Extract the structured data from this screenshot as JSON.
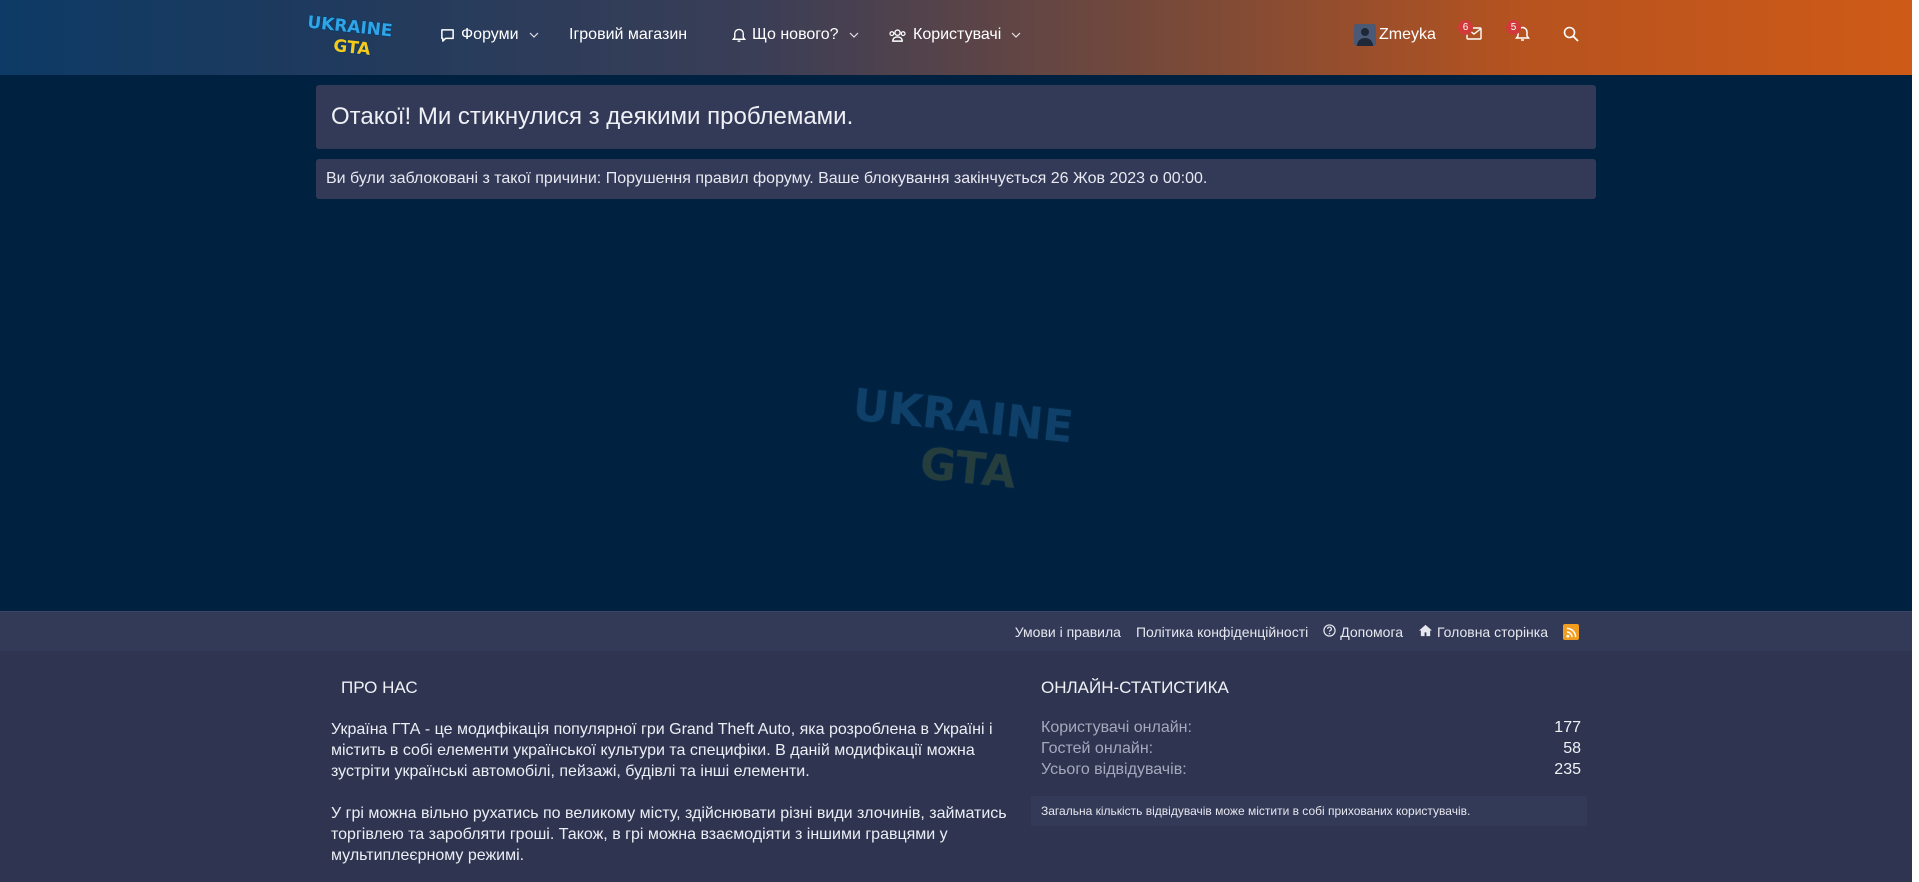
{
  "header": {
    "logo_line1": "UKRAINE",
    "logo_line2": "GTA",
    "nav": [
      {
        "label": "Форуми",
        "icon": "comment-icon"
      },
      {
        "label": "Ігровий магазин"
      },
      {
        "label": "Що нового?",
        "icon": "bell-icon"
      },
      {
        "label": "Користувачі",
        "icon": "users-icon"
      }
    ],
    "user": {
      "name": "Zmeyka"
    },
    "conversations_count": "6",
    "alerts_count": "5"
  },
  "main": {
    "title": "Отакої! Ми стикнулися з деякими проблемами.",
    "message": "Ви були заблоковані з такої причини: Порушення правил форуму. Ваше блокування закінчується 26 Жов 2023 о 00:00.",
    "watermark_line1": "UKRAINE",
    "watermark_line2": "GTA"
  },
  "footer": {
    "links": {
      "terms": "Умови і правила",
      "privacy": "Політика конфіденційності",
      "help": "Допомога",
      "home": "Головна сторінка"
    },
    "about": {
      "heading": "ПРО НАС",
      "p1_lines": [
        "Україна ГТА - це модифікація популярної гри Grand Theft Auto, яка розроблена в Україні і",
        "містить в собі елементи української культури та специфіки. В даній модифікації можна",
        "зустріти українські автомобілі, пейзажі, будівлі та інші елементи."
      ],
      "p2_lines": [
        "У грі можна вільно рухатись по великому місту, здійснювати різні види злочинів, займатись",
        "торгівлею та заробляти гроші. Також, в грі можна взаємодіяти з іншими гравцями у",
        "мультиплеєрному режимі."
      ]
    },
    "stats": {
      "heading": "ОНЛАЙН-СТАТИСТИКА",
      "rows": [
        {
          "label": "Користувачі онлайн:",
          "value": "177"
        },
        {
          "label": "Гостей онлайн:",
          "value": "58"
        },
        {
          "label": "Усього відвідувачів:",
          "value": "235"
        }
      ],
      "note": "Загальна кількість відвідувачів може містити в собі прихованих користувачів."
    }
  },
  "colors": {
    "page_bg": "#00213f",
    "panel": "#333a58",
    "footer": "#2f3550",
    "badge": "#d03a3a",
    "rss": "#f29d1f"
  }
}
